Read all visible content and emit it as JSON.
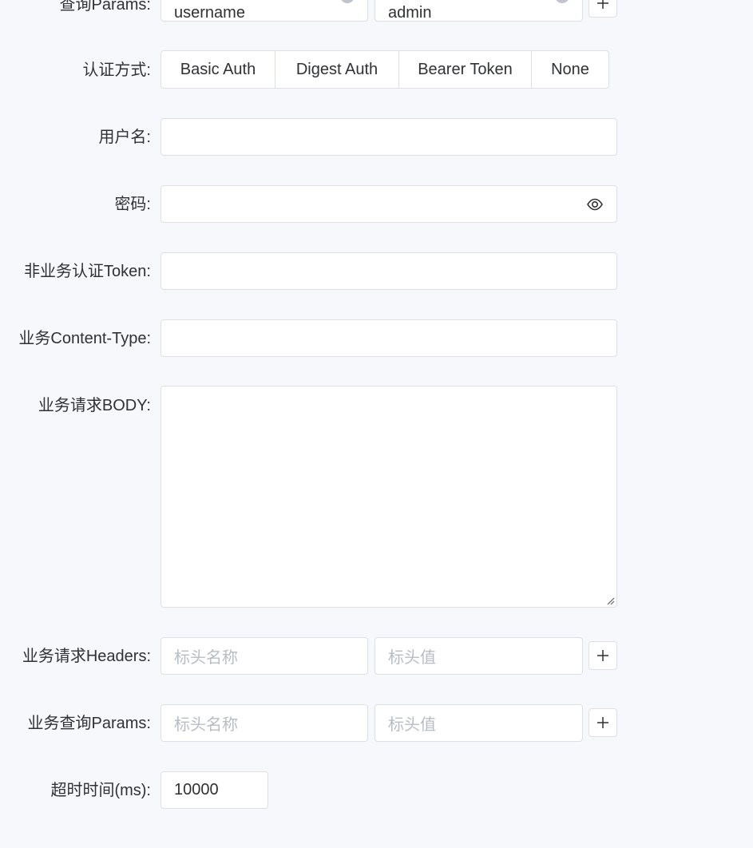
{
  "query_params_top": {
    "label": "查询Params:",
    "key_value": "username",
    "value_value": "admin"
  },
  "auth": {
    "label": "认证方式:",
    "options": [
      "Basic Auth",
      "Digest Auth",
      "Bearer Token",
      "None"
    ]
  },
  "username": {
    "label": "用户名:",
    "value": ""
  },
  "password": {
    "label": "密码:",
    "value": ""
  },
  "token": {
    "label": "非业务认证Token:",
    "value": ""
  },
  "content_type": {
    "label": "业务Content-Type:",
    "value": ""
  },
  "body": {
    "label": "业务请求BODY:",
    "value": ""
  },
  "headers": {
    "label": "业务请求Headers:",
    "key_placeholder": "标头名称",
    "value_placeholder": "标头值"
  },
  "query_params": {
    "label": "业务查询Params:",
    "key_placeholder": "标头名称",
    "value_placeholder": "标头值"
  },
  "timeout": {
    "label": "超时时间(ms):",
    "value": "10000"
  },
  "icons": {
    "clear": "clear-circle-icon",
    "plus": "plus-icon",
    "eye": "eye-icon",
    "resize": "resize-handle-icon"
  },
  "colors": {
    "background": "#f7f8fc",
    "border": "#dcdfe6",
    "text": "#303133",
    "placeholder": "#b8bcc4"
  }
}
